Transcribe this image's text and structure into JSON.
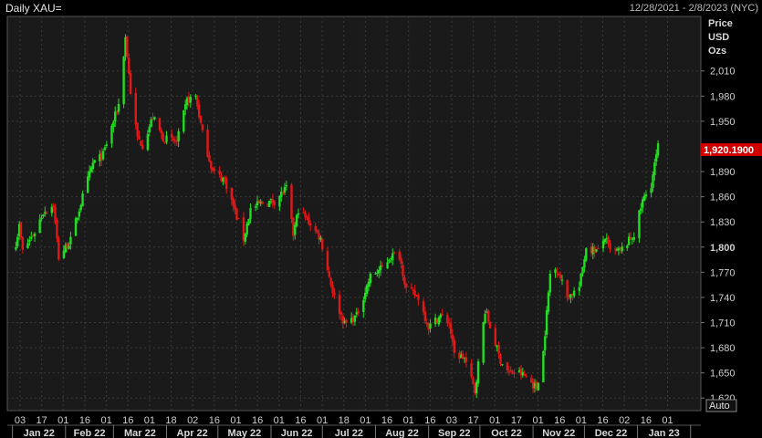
{
  "header": {
    "title": "Daily XAU=",
    "date_range": "12/28/2021 - 2/8/2023 (NYC)"
  },
  "axis_labels": {
    "price": "Price",
    "currency": "USD",
    "unit": "Ozs",
    "auto_button": "Auto"
  },
  "colors": {
    "background": "#1a1a1a",
    "up": "#22dd22",
    "down": "#e01818",
    "grid": "#3a3a3a",
    "last_price_bg": "#d00000"
  },
  "chart_data": {
    "type": "candlestick",
    "ylim": [
      1605,
      2075
    ],
    "y_ticks": [
      1620,
      1650,
      1680,
      1710,
      1740,
      1770,
      1800,
      1830,
      1860,
      1890,
      1950,
      1980,
      2010
    ],
    "y_tick_labels": [
      "1,620",
      "1,650",
      "1,680",
      "1,710",
      "1,740",
      "1,770",
      "1,800",
      "1,830",
      "1,860",
      "1,890",
      "1,950",
      "1,980",
      "2,010"
    ],
    "last_price": 1920.19,
    "last_price_label": "1,920.1900",
    "x_day_labels": [
      "03",
      "17",
      "01",
      "16",
      "01",
      "16",
      "01",
      "18",
      "02",
      "16",
      "01",
      "16",
      "01",
      "16",
      "01",
      "18",
      "01",
      "16",
      "01",
      "16",
      "03",
      "17",
      "01",
      "17",
      "01",
      "16",
      "01",
      "16",
      "02",
      "16",
      "01"
    ],
    "x_month_labels": [
      "Jan 22",
      "Feb 22",
      "Mar 22",
      "Apr 22",
      "May 22",
      "Jun 22",
      "Jul 22",
      "Aug 22",
      "Sep 22",
      "Oct 22",
      "Nov 22",
      "Dec 22",
      "Jan 23"
    ],
    "close_path": [
      [
        "2022-01-03",
        1805
      ],
      [
        "2022-01-05",
        1825
      ],
      [
        "2022-01-07",
        1795
      ],
      [
        "2022-01-14",
        1818
      ],
      [
        "2022-01-19",
        1842
      ],
      [
        "2022-01-25",
        1850
      ],
      [
        "2022-01-28",
        1788
      ],
      [
        "2022-02-04",
        1808
      ],
      [
        "2022-02-11",
        1860
      ],
      [
        "2022-02-17",
        1900
      ],
      [
        "2022-02-23",
        1910
      ],
      [
        "2022-03-04",
        1970
      ],
      [
        "2022-03-08",
        2050
      ],
      [
        "2022-03-11",
        1985
      ],
      [
        "2022-03-15",
        1930
      ],
      [
        "2022-03-18",
        1922
      ],
      [
        "2022-03-24",
        1955
      ],
      [
        "2022-03-30",
        1930
      ],
      [
        "2022-04-07",
        1925
      ],
      [
        "2022-04-13",
        1975
      ],
      [
        "2022-04-18",
        1980
      ],
      [
        "2022-04-22",
        1935
      ],
      [
        "2022-04-28",
        1890
      ],
      [
        "2022-05-05",
        1880
      ],
      [
        "2022-05-09",
        1855
      ],
      [
        "2022-05-16",
        1810
      ],
      [
        "2022-05-20",
        1845
      ],
      [
        "2022-05-26",
        1852
      ],
      [
        "2022-06-03",
        1855
      ],
      [
        "2022-06-10",
        1870
      ],
      [
        "2022-06-14",
        1815
      ],
      [
        "2022-06-17",
        1845
      ],
      [
        "2022-06-24",
        1828
      ],
      [
        "2022-06-30",
        1810
      ],
      [
        "2022-07-05",
        1765
      ],
      [
        "2022-07-08",
        1740
      ],
      [
        "2022-07-14",
        1708
      ],
      [
        "2022-07-21",
        1718
      ],
      [
        "2022-07-29",
        1765
      ],
      [
        "2022-08-05",
        1775
      ],
      [
        "2022-08-10",
        1790
      ],
      [
        "2022-08-15",
        1790
      ],
      [
        "2022-08-19",
        1750
      ],
      [
        "2022-08-26",
        1740
      ],
      [
        "2022-09-01",
        1705
      ],
      [
        "2022-09-08",
        1718
      ],
      [
        "2022-09-13",
        1710
      ],
      [
        "2022-09-16",
        1672
      ],
      [
        "2022-09-22",
        1668
      ],
      [
        "2022-09-28",
        1628
      ],
      [
        "2022-10-04",
        1725
      ],
      [
        "2022-10-07",
        1705
      ],
      [
        "2022-10-13",
        1665
      ],
      [
        "2022-10-18",
        1650
      ],
      [
        "2022-10-24",
        1650
      ],
      [
        "2022-10-28",
        1645
      ],
      [
        "2022-11-03",
        1632
      ],
      [
        "2022-11-07",
        1675
      ],
      [
        "2022-11-11",
        1768
      ],
      [
        "2022-11-15",
        1775
      ],
      [
        "2022-11-21",
        1740
      ],
      [
        "2022-11-28",
        1752
      ],
      [
        "2022-12-02",
        1800
      ],
      [
        "2022-12-09",
        1795
      ],
      [
        "2022-12-13",
        1812
      ],
      [
        "2022-12-16",
        1795
      ],
      [
        "2022-12-22",
        1795
      ],
      [
        "2022-12-30",
        1815
      ],
      [
        "2023-01-04",
        1855
      ],
      [
        "2023-01-09",
        1875
      ],
      [
        "2023-01-13",
        1920
      ]
    ]
  }
}
